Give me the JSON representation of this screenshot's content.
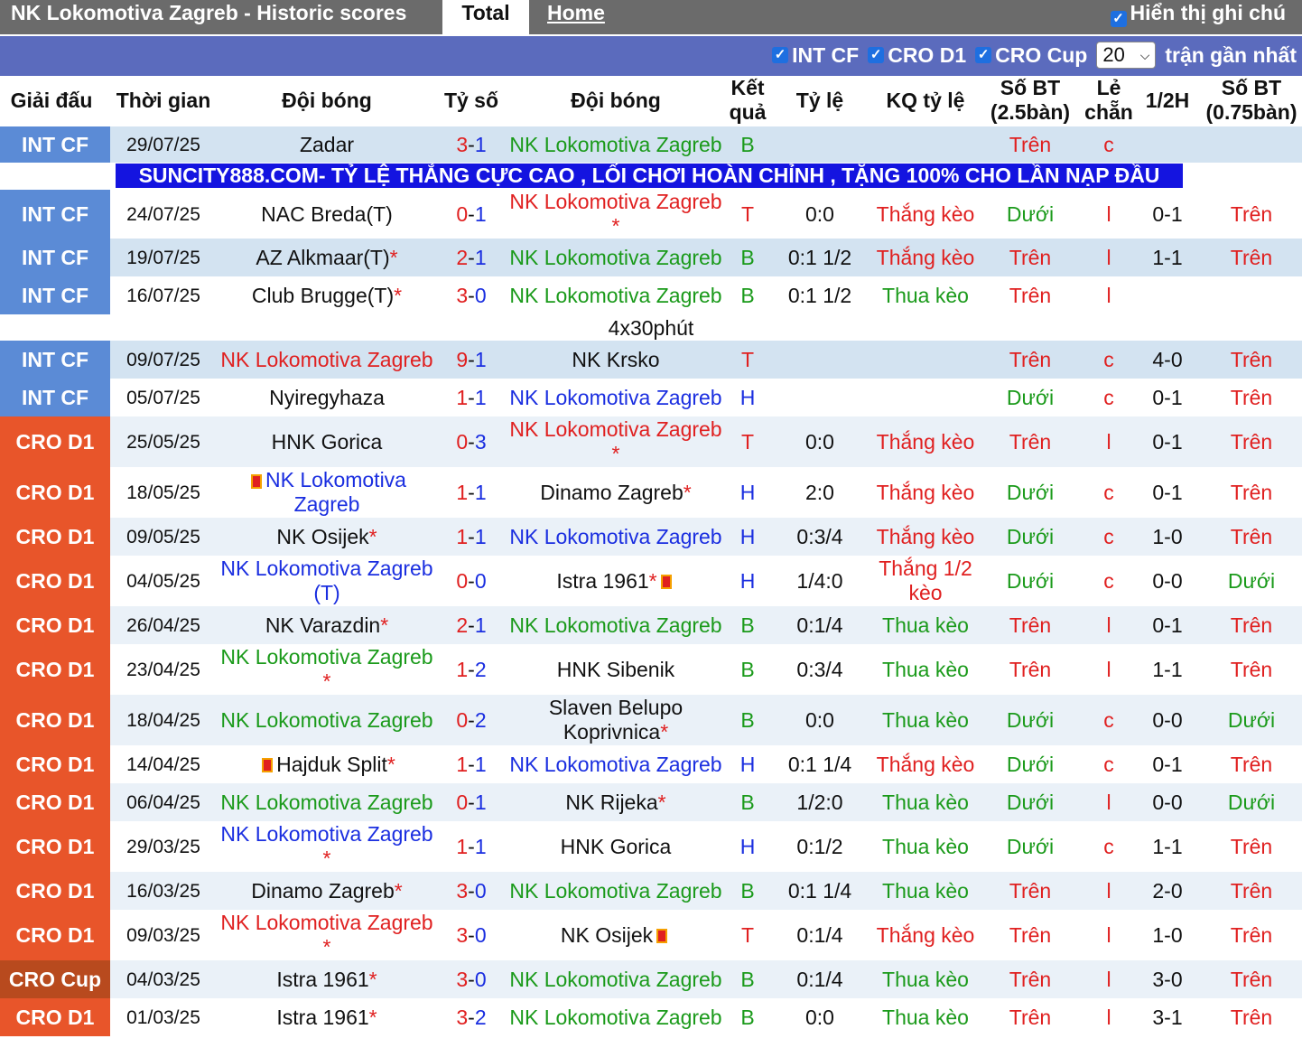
{
  "header": {
    "title": "NK Lokomotiva Zagreb - Historic scores",
    "tab_total": "Total",
    "tab_home": "Home",
    "note_label": "Hiển thị ghi chú"
  },
  "filters": {
    "int_cf": "INT CF",
    "cro_d1": "CRO D1",
    "cro_cup": "CRO Cup",
    "count": "20",
    "count_suffix": "trận gần nhất"
  },
  "columns": {
    "league": "Giải đấu",
    "date": "Thời gian",
    "home": "Đội bóng",
    "score": "Tỷ số",
    "away": "Đội bóng",
    "result": "Kết quả",
    "odds": "Tỷ lệ",
    "odds_result": "KQ tỷ lệ",
    "goals25": "Số BT (2.5bàn)",
    "odd_even": "Lẻ chẵn",
    "half": "1/2H",
    "goals075": "Số BT (0.75bàn)"
  },
  "banner": "SUNCITY888.COM- TỶ LỆ THẮNG CỰC CAO , LỐI CHƠI HOÀN CHỈNH , TẶNG 100% CHO LẦN NẠP ĐẦU",
  "separator_note": "4x30phút",
  "matches": [
    {
      "league": "INT CF",
      "date": "29/07/25",
      "home": "Zadar",
      "score": "3-1",
      "away": "NK Lokomotiva Zagreb",
      "result": "B",
      "odds": "",
      "odds_result": "",
      "goals25": "Trên",
      "odd_even": "c",
      "half": "",
      "goals075": ""
    },
    {
      "league": "INT CF",
      "date": "24/07/25",
      "home": "NAC Breda(T)",
      "score": "0-1",
      "away": "NK Lokomotiva Zagreb *",
      "result": "T",
      "odds": "0:0",
      "odds_result": "Thắng kèo",
      "goals25": "Dưới",
      "odd_even": "l",
      "half": "0-1",
      "goals075": "Trên"
    },
    {
      "league": "INT CF",
      "date": "19/07/25",
      "home": "AZ Alkmaar(T)*",
      "score": "2-1",
      "away": "NK Lokomotiva Zagreb",
      "result": "B",
      "odds": "0:1 1/2",
      "odds_result": "Thắng kèo",
      "goals25": "Trên",
      "odd_even": "l",
      "half": "1-1",
      "goals075": "Trên"
    },
    {
      "league": "INT CF",
      "date": "16/07/25",
      "home": "Club Brugge(T)*",
      "score": "3-0",
      "away": "NK Lokomotiva Zagreb",
      "result": "B",
      "odds": "0:1 1/2",
      "odds_result": "Thua kèo",
      "goals25": "Trên",
      "odd_even": "l",
      "half": "",
      "goals075": ""
    },
    {
      "league": "INT CF",
      "date": "09/07/25",
      "home": "NK Lokomotiva Zagreb",
      "score": "9-1",
      "away": "NK Krsko",
      "result": "T",
      "odds": "",
      "odds_result": "",
      "goals25": "Trên",
      "odd_even": "c",
      "half": "4-0",
      "goals075": "Trên"
    },
    {
      "league": "INT CF",
      "date": "05/07/25",
      "home": "Nyiregyhaza",
      "score": "1-1",
      "away": "NK Lokomotiva Zagreb",
      "result": "H",
      "odds": "",
      "odds_result": "",
      "goals25": "Dưới",
      "odd_even": "c",
      "half": "0-1",
      "goals075": "Trên"
    },
    {
      "league": "CRO D1",
      "date": "25/05/25",
      "home": "HNK Gorica",
      "score": "0-3",
      "away": "NK Lokomotiva Zagreb *",
      "result": "T",
      "odds": "0:0",
      "odds_result": "Thắng kèo",
      "goals25": "Trên",
      "odd_even": "l",
      "half": "0-1",
      "goals075": "Trên"
    },
    {
      "league": "CRO D1",
      "date": "18/05/25",
      "home": "NK Lokomotiva Zagreb",
      "score": "1-1",
      "away": "Dinamo Zagreb*",
      "result": "H",
      "odds": "2:0",
      "odds_result": "Thắng kèo",
      "goals25": "Dưới",
      "odd_even": "c",
      "half": "0-1",
      "goals075": "Trên"
    },
    {
      "league": "CRO D1",
      "date": "09/05/25",
      "home": "NK Osijek*",
      "score": "1-1",
      "away": "NK Lokomotiva Zagreb",
      "result": "H",
      "odds": "0:3/4",
      "odds_result": "Thắng kèo",
      "goals25": "Dưới",
      "odd_even": "c",
      "half": "1-0",
      "goals075": "Trên"
    },
    {
      "league": "CRO D1",
      "date": "04/05/25",
      "home": "NK Lokomotiva Zagreb (T)",
      "score": "0-0",
      "away": "Istra 1961*",
      "result": "H",
      "odds": "1/4:0",
      "odds_result": "Thắng 1/2 kèo",
      "goals25": "Dưới",
      "odd_even": "c",
      "half": "0-0",
      "goals075": "Dưới"
    },
    {
      "league": "CRO D1",
      "date": "26/04/25",
      "home": "NK Varazdin*",
      "score": "2-1",
      "away": "NK Lokomotiva Zagreb",
      "result": "B",
      "odds": "0:1/4",
      "odds_result": "Thua kèo",
      "goals25": "Trên",
      "odd_even": "l",
      "half": "0-1",
      "goals075": "Trên"
    },
    {
      "league": "CRO D1",
      "date": "23/04/25",
      "home": "NK Lokomotiva Zagreb *",
      "score": "1-2",
      "away": "HNK Sibenik",
      "result": "B",
      "odds": "0:3/4",
      "odds_result": "Thua kèo",
      "goals25": "Trên",
      "odd_even": "l",
      "half": "1-1",
      "goals075": "Trên"
    },
    {
      "league": "CRO D1",
      "date": "18/04/25",
      "home": "NK Lokomotiva Zagreb",
      "score": "0-2",
      "away": "Slaven Belupo Koprivnica*",
      "result": "B",
      "odds": "0:0",
      "odds_result": "Thua kèo",
      "goals25": "Dưới",
      "odd_even": "c",
      "half": "0-0",
      "goals075": "Dưới"
    },
    {
      "league": "CRO D1",
      "date": "14/04/25",
      "home": "Hajduk Split*",
      "score": "1-1",
      "away": "NK Lokomotiva Zagreb",
      "result": "H",
      "odds": "0:1 1/4",
      "odds_result": "Thắng kèo",
      "goals25": "Dưới",
      "odd_even": "c",
      "half": "0-1",
      "goals075": "Trên"
    },
    {
      "league": "CRO D1",
      "date": "06/04/25",
      "home": "NK Lokomotiva Zagreb",
      "score": "0-1",
      "away": "NK Rijeka*",
      "result": "B",
      "odds": "1/2:0",
      "odds_result": "Thua kèo",
      "goals25": "Dưới",
      "odd_even": "l",
      "half": "0-0",
      "goals075": "Dưới"
    },
    {
      "league": "CRO D1",
      "date": "29/03/25",
      "home": "NK Lokomotiva Zagreb *",
      "score": "1-1",
      "away": "HNK Gorica",
      "result": "H",
      "odds": "0:1/2",
      "odds_result": "Thua kèo",
      "goals25": "Dưới",
      "odd_even": "c",
      "half": "1-1",
      "goals075": "Trên"
    },
    {
      "league": "CRO D1",
      "date": "16/03/25",
      "home": "Dinamo Zagreb*",
      "score": "3-0",
      "away": "NK Lokomotiva Zagreb",
      "result": "B",
      "odds": "0:1 1/4",
      "odds_result": "Thua kèo",
      "goals25": "Trên",
      "odd_even": "l",
      "half": "2-0",
      "goals075": "Trên"
    },
    {
      "league": "CRO D1",
      "date": "09/03/25",
      "home": "NK Lokomotiva Zagreb *",
      "score": "3-0",
      "away": "NK Osijek",
      "result": "T",
      "odds": "0:1/4",
      "odds_result": "Thắng kèo",
      "goals25": "Trên",
      "odd_even": "l",
      "half": "1-0",
      "goals075": "Trên"
    },
    {
      "league": "CRO Cup",
      "date": "04/03/25",
      "home": "Istra 1961*",
      "score": "3-0",
      "away": "NK Lokomotiva Zagreb",
      "result": "B",
      "odds": "0:1/4",
      "odds_result": "Thua kèo",
      "goals25": "Trên",
      "odd_even": "l",
      "half": "3-0",
      "goals075": "Trên"
    },
    {
      "league": "CRO D1",
      "date": "01/03/25",
      "home": "Istra 1961*",
      "score": "3-2",
      "away": "NK Lokomotiva Zagreb",
      "result": "B",
      "odds": "0:0",
      "odds_result": "Thua kèo",
      "goals25": "Trên",
      "odd_even": "l",
      "half": "3-1",
      "goals075": "Trên"
    }
  ]
}
